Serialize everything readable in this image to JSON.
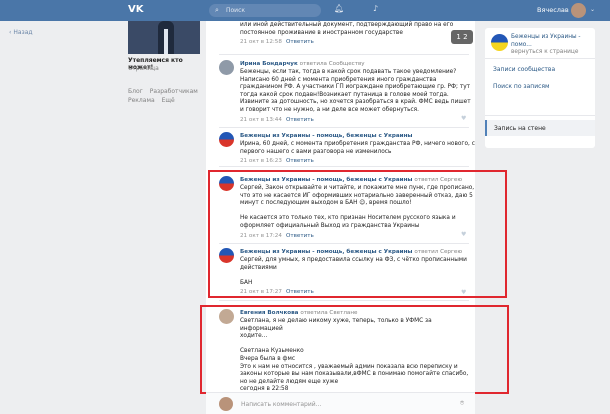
{
  "topbar": {
    "logo": "VK",
    "search_placeholder": "Поиск",
    "user_name": "Вячеслав",
    "search_icon": "search-icon",
    "bell_icon": "bell-icon",
    "music_icon": "music-icon"
  },
  "back_link": "Назад",
  "left": {
    "profile_title": "Утепляемся кто может!",
    "profile_sub": "Страница",
    "footer": [
      "Блог",
      "Разработчикам",
      "Реклама",
      "Ещё"
    ]
  },
  "scroll_badge": "1 2",
  "comments": [
    {
      "text": "или иной действительный документ, подтверждающий право на его\nпостоянное проживание в иностранном государстве",
      "time": "21 окт в 12:58",
      "reply": "Ответить"
    },
    {
      "author": "Ирина Бондарчук",
      "reply_to": "ответила Сообществу",
      "text": "Беженцы, если так, тогда в какой срок подавать такое уведомление?\nНаписано 60 дней с момента приобретения иного гражданства\nгражданином РФ. А участники ГП иограждане приобретающие гр. РФ; тут\nтогда какой срок подавн!Возникает путаница в голове моей тогда.\nИзвините за дотошность, но хочется разобраться в край. ФМС ведь пишет\nи говорит что не нужно, а ни деле все может обернуться.",
      "time": "21 окт в 13:44",
      "reply": "Ответить"
    },
    {
      "author": "Беженцы из Украины - помощь, беженцы с Украины",
      "text": "Ирина, 60 дней, с момента приобретения гражданства РФ, ничего нового, с\nпервого нашего с вами разговора не изменилось",
      "time": "21 окт в 16:23",
      "reply": "Ответить"
    },
    {
      "author": "Беженцы из Украины - помощь, беженцы с Украины",
      "reply_to": "ответил Сергею",
      "text": "Сергей, Закон открывайте и читайте, и покажите мне пунк, где прописано,\nчто это не касается ИГ оформивших нотариально заверенный отказ, даю 5\nминут с последующим выходом в БАН 😉, время пошло!\n\nНе касается это только тех, кто признан Носителем русского языка и\nоформляет официальный Выход из гражданства Украины",
      "time": "21 окт в 17:24",
      "reply": "Ответить"
    },
    {
      "author": "Беженцы из Украины - помощь, беженцы с Украины",
      "reply_to": "ответил Сергею",
      "text": "Сергей, для умных, я предоставила ссылку на ФЗ, с чётко прописанными\nдействиями\n\nБАН",
      "time": "21 окт в 17:27",
      "reply": "Ответить"
    },
    {
      "author": "Евгения Волчкова",
      "reply_to": "ответила Светлане",
      "text": "Светлана, я не делаю никому хуже, теперь, только в УФМС за информацией\nходите...\n\nСветлана Кузьменко\nВчера была в фмс\nЭто к нам не относится , уважаемый админ показала всю переписку и\nзаконы которые вы нам показывали,вФМС в понимаю помогайте спасибо,\nно не делайте людям еще хуже\nсегодня в 22:58",
      "time": "",
      "reply": ""
    }
  ],
  "reply_placeholder": "Написать комментарий...",
  "right_panel": {
    "group_title": "Беженцы из Украины - помо...",
    "group_sub": "вернуться к странице",
    "items": [
      "Записи сообщества",
      "Поиск по записям",
      "Запись на стене"
    ]
  },
  "colors": {
    "header": "#4a76a8",
    "link": "#2a5885",
    "highlight_box": "#e0272f"
  }
}
